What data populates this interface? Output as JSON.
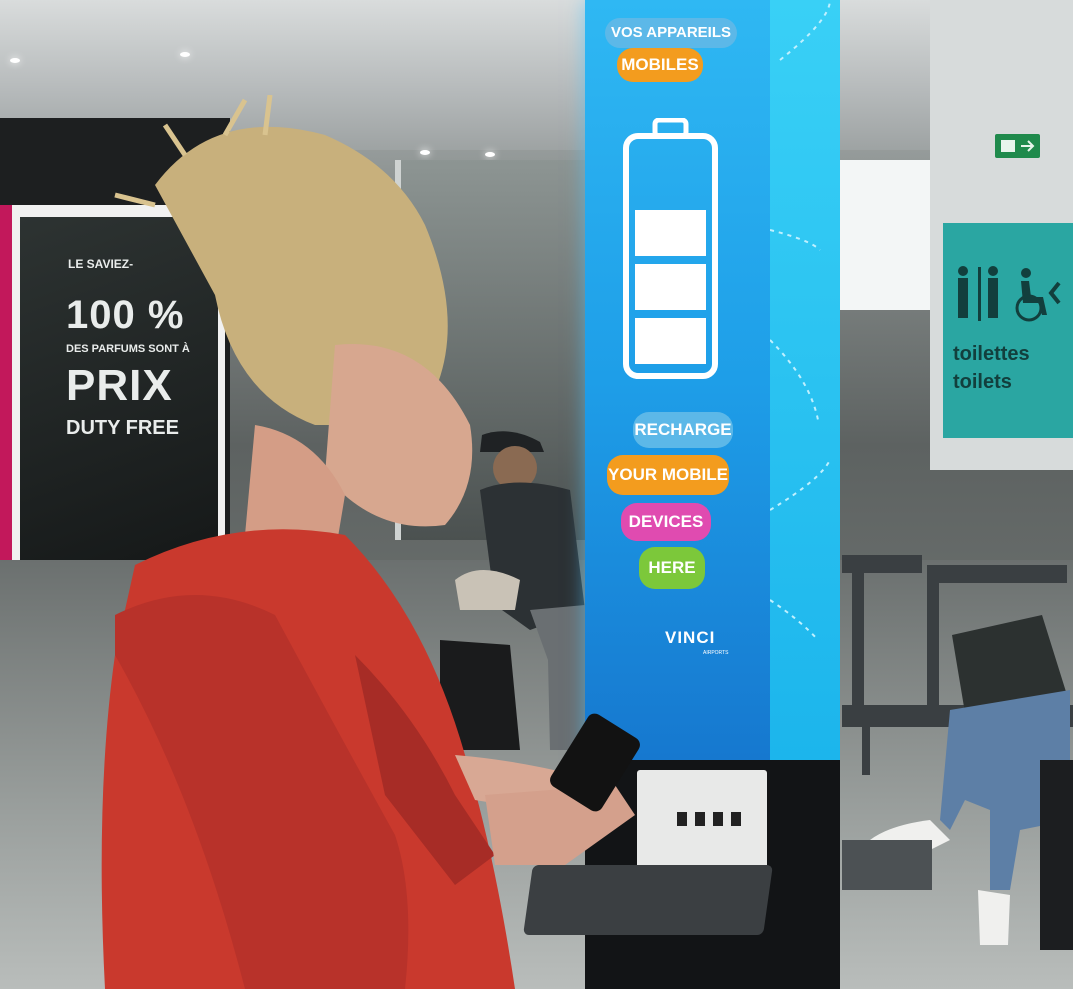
{
  "poster": {
    "headline_small": "LE SAVIEZ-",
    "percent": "100 %",
    "subline": "DES PARFUMS SONT À",
    "word_prix": "PRIX",
    "duty_free": "DUTY FREE",
    "accent_color": "#c2185b"
  },
  "kiosk": {
    "bubbles_top": [
      "VOS APPAREILS",
      "MOBILES"
    ],
    "bubbles_bottom": [
      "RECHARGE",
      "YOUR MOBILE",
      "DEVICES",
      "HERE"
    ],
    "brand": "VINCI",
    "brand_sub": "AIRPORTS",
    "screen_color": "#1e9ee8",
    "bubble_colors": [
      "#5cb8e8",
      "#f39c1e",
      "#e04bb0",
      "#7cc83a"
    ]
  },
  "signs": {
    "toilets_fr": "toilettes",
    "toilets_en": "toilets",
    "exit_icon": "emergency-exit-icon",
    "sign_color": "#2aa6a2"
  }
}
